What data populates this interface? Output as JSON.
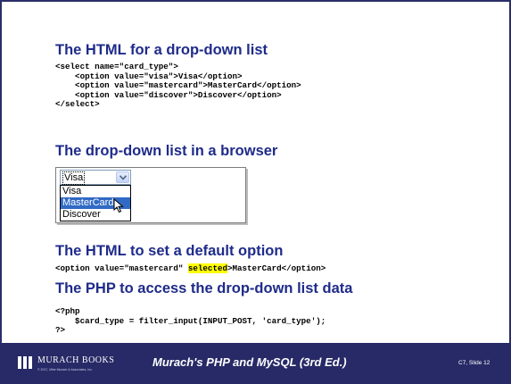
{
  "slide": {
    "heading1": "The HTML for a drop-down list",
    "code1": "<select name=\"card_type\">\n    <option value=\"visa\">Visa</option>\n    <option value=\"mastercard\">MasterCard</option>\n    <option value=\"discover\">Discover</option>\n</select>",
    "heading2": "The drop-down list in a browser",
    "heading3": "The HTML to set a default option",
    "code3_before": "<option value=\"mastercard\" ",
    "code3_highlight": "selected",
    "code3_after": ">MasterCard</option>",
    "heading4": "The PHP to access the drop-down list data",
    "code4": "<?php\n    $card_type = filter_input(INPUT_POST, 'card_type');\n?>"
  },
  "demo": {
    "selected_value": "Visa",
    "options": [
      "Visa",
      "MasterCard",
      "Discover"
    ],
    "highlighted_option": "MasterCard",
    "dropdown_icon": "chevron-down-icon",
    "cursor_icon": "pointer-cursor-icon"
  },
  "footer": {
    "logo_text": "MURACH BOOKS",
    "copyright": "© 2017, Mike Murach & Associates, Inc.",
    "title": "Murach's PHP and MySQL (3rd Ed.)",
    "slide_number": "C7, Slide 12"
  },
  "colors": {
    "heading": "#1f2b8a",
    "footer_bg": "#272a66",
    "highlight": "#ffff00",
    "selection": "#316ac5"
  }
}
